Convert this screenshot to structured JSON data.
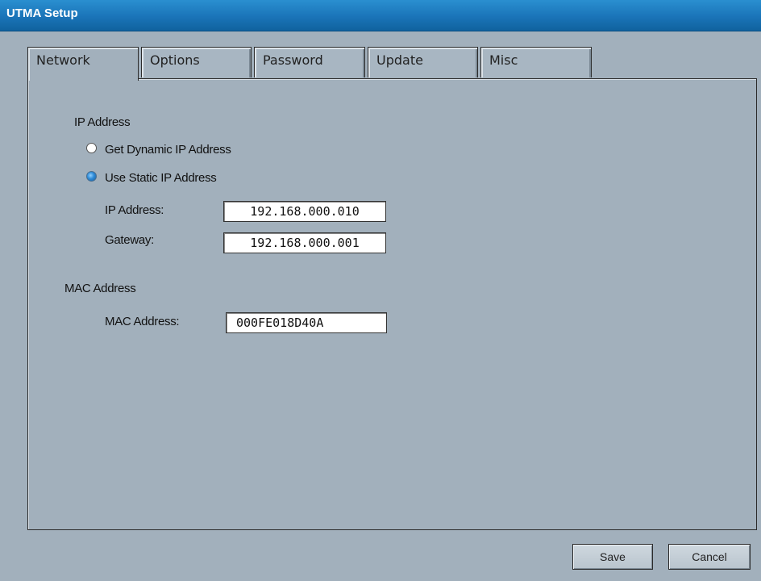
{
  "window": {
    "title": "UTMA Setup"
  },
  "tabs": [
    {
      "label": "Network",
      "active": true
    },
    {
      "label": "Options",
      "active": false
    },
    {
      "label": "Password",
      "active": false
    },
    {
      "label": "Update",
      "active": false
    },
    {
      "label": "Misc",
      "active": false
    }
  ],
  "network": {
    "ip_section_label": "IP Address",
    "dynamic_option_label": "Get Dynamic IP Address",
    "static_option_label": "Use Static IP Address",
    "selected_option": "static",
    "ip_address_label": "IP Address:",
    "ip_address_value": "192.168.000.010",
    "gateway_label": "Gateway:",
    "gateway_value": "192.168.000.001",
    "mac_section_label": "MAC Address",
    "mac_address_label": "MAC Address:",
    "mac_address_value": "000FE018D40A"
  },
  "buttons": {
    "save_label": "Save",
    "cancel_label": "Cancel"
  },
  "colors": {
    "titlebar": "#1a74b8",
    "background": "#a2b0bc",
    "radio_selected": "#2e8ad6"
  }
}
